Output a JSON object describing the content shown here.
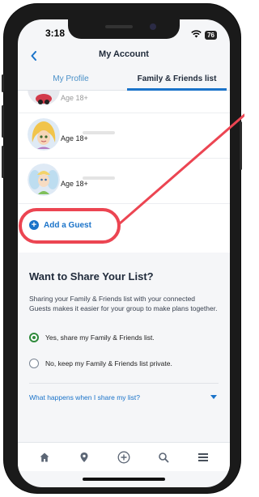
{
  "status_bar": {
    "time": "3:18",
    "battery": "76"
  },
  "header": {
    "title": "My Account"
  },
  "tabs": [
    {
      "label": "My Profile",
      "active": false
    },
    {
      "label": "Family & Friends list",
      "active": true
    }
  ],
  "guests": [
    {
      "age": "Age 18+",
      "partial": true
    },
    {
      "age": "Age 18+",
      "partial": false
    },
    {
      "age": "Age 18+",
      "partial": false
    }
  ],
  "add_guest": {
    "label": "Add a Guest",
    "icon": "plus-circle-icon"
  },
  "share": {
    "title": "Want to Share Your List?",
    "description": "Sharing your Family & Friends list with your connected Guests makes it easier for your group to make plans together.",
    "options": [
      {
        "label": "Yes, share my Family & Friends list.",
        "checked": true
      },
      {
        "label": "No, keep my Family & Friends list private.",
        "checked": false
      }
    ],
    "faq_link": "What happens when I share my list?"
  },
  "bottom_nav": [
    {
      "icon": "home-icon"
    },
    {
      "icon": "map-pin-icon"
    },
    {
      "icon": "add-circle-icon"
    },
    {
      "icon": "search-icon"
    },
    {
      "icon": "menu-icon"
    }
  ],
  "colors": {
    "accent": "#1a73c9",
    "annotation": "#ec4552",
    "radio_checked": "#2f8a3c"
  }
}
